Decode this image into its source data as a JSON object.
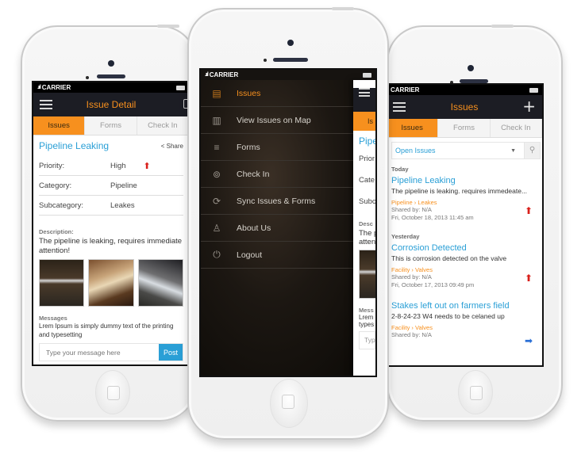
{
  "status_bar": {
    "carrier": "CARRIER",
    "signal_glyph": ".ııl"
  },
  "left_phone": {
    "appbar_title": "Issue Detail",
    "tabs": [
      {
        "label": "Issues",
        "active": true
      },
      {
        "label": "Forms",
        "active": false
      },
      {
        "label": "Check In",
        "active": false
      }
    ],
    "issue_title": "Pipeline Leaking",
    "share_label": "Share",
    "fields": [
      {
        "label": "Priority:",
        "value": "High",
        "priority_icon": "arrow-up-red"
      },
      {
        "label": "Category:",
        "value": "Pipeline"
      },
      {
        "label": "Subcategory:",
        "value": "Leakes"
      }
    ],
    "description_label": "Description:",
    "description": "The pipeline is leaking, requires immediate attention!",
    "photos": [
      "water-leak-photo",
      "pipeline-photo",
      "pipe-damage-photo"
    ],
    "messages_label": "Messages",
    "message_text": "Lrem Ipsum is simply dummy text of the printing and typesetting",
    "composer": {
      "placeholder": "Type your message here",
      "value": "",
      "post_label": "Post"
    }
  },
  "middle_phone": {
    "menu_items": [
      {
        "label": "Issues",
        "icon": "issues-icon",
        "glyph": "▤",
        "active": true
      },
      {
        "label": "View Issues on Map",
        "icon": "map-icon",
        "glyph": "▥",
        "active": false
      },
      {
        "label": "Forms",
        "icon": "list-icon",
        "glyph": "≡",
        "active": false
      },
      {
        "label": "Check In",
        "icon": "location-pin-icon",
        "glyph": "⊚",
        "active": false
      },
      {
        "label": "Sync Issues & Forms",
        "icon": "sync-icon",
        "glyph": "⟳",
        "active": false
      },
      {
        "label": "About Us",
        "icon": "user-icon",
        "glyph": "♙",
        "active": false
      },
      {
        "label": "Logout",
        "icon": "power-icon",
        "glyph": "⏻",
        "active": false
      }
    ],
    "peek": {
      "tab": "Is",
      "title": "Pipe",
      "rows": [
        "Prior",
        "Cate",
        "Subc"
      ],
      "desc_label": "Desc",
      "desc": "The p",
      "desc2": "atten",
      "messages_label": "Mess",
      "msg1": "Lrem",
      "msg2": "types",
      "composer_placeholder": "Typ"
    }
  },
  "right_phone": {
    "appbar_title": "Issues",
    "add_glyph": "+",
    "tabs": [
      {
        "label": "Issues",
        "active": true
      },
      {
        "label": "Forms",
        "active": false
      },
      {
        "label": "Check In",
        "active": false
      }
    ],
    "filter": {
      "selected": "Open Issues",
      "caret": "▼",
      "search_glyph": "⚲"
    },
    "groups": [
      {
        "label": "Today",
        "issues": [
          {
            "title": "Pipeline Leaking",
            "description": "The pipeline is leaking. requires immedeate...",
            "category": "Pipeline › Leakes",
            "shared_by": "Shared by: N/A",
            "timestamp": "Fri, October 18, 2013    11:45 am",
            "priority": "high"
          }
        ]
      },
      {
        "label": "Yesterday",
        "issues": [
          {
            "title": "Corrosion Detected",
            "description": "This is corrosion detected on the valve",
            "category": "Facility › Valves",
            "shared_by": "Shared by: N/A",
            "timestamp": "Fri, October 17, 2013    09:49 pm",
            "priority": "high"
          },
          {
            "title": "Stakes left out on farmers field",
            "description": "2-8-24-23 W4 needs to be celaned up",
            "category": "Facility › Valves",
            "shared_by": "Shared by: N/A",
            "timestamp": "",
            "priority": "normal"
          }
        ]
      }
    ]
  },
  "colors": {
    "accent": "#f7901e",
    "link": "#2a9fd6",
    "priority_high": "#d9201b",
    "appbar": "#1c1d24"
  },
  "glyphs": {
    "arrow_up": "⬆",
    "arrow_right": "➡"
  }
}
